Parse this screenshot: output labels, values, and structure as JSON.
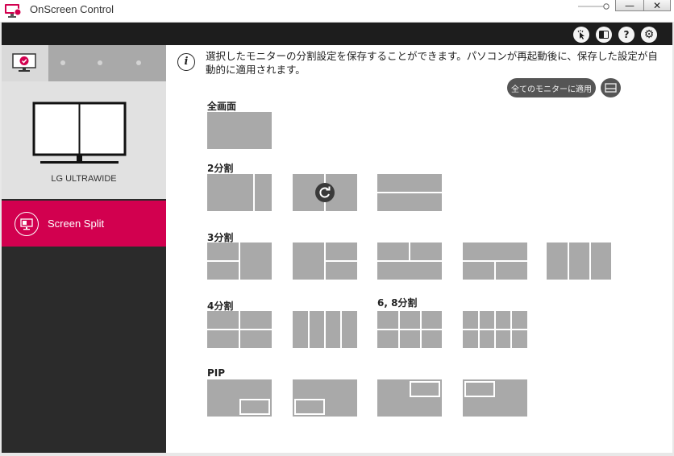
{
  "window": {
    "title": "OnScreen Control",
    "minimize_glyph": "—",
    "close_glyph": "✕"
  },
  "toolbar": {
    "icons": [
      "cursor-icon",
      "display-icon",
      "help-icon",
      "settings-icon"
    ],
    "help_glyph": "?",
    "settings_glyph": "⚙"
  },
  "sidebar": {
    "monitor_name": "LG ULTRAWIDE",
    "menu_items": [
      {
        "label": "Screen Split",
        "active": true
      }
    ]
  },
  "main": {
    "info_glyph": "i",
    "info_text": "選択したモニターの分割設定を保存することができます。パソコンが再起動後に、保存した設定が自動的に適用されます。",
    "apply_all_label": "全てのモニターに適用",
    "sections": {
      "full": "全画面",
      "split2": "2分割",
      "split3": "3分割",
      "split4": "4分割",
      "split68": "6, 8分割",
      "pip": "PIP"
    }
  },
  "colors": {
    "accent": "#d2004f",
    "sidebar_bg": "#2b2b2b",
    "toolbar_bg": "#1d1d1d",
    "layout_gray": "#a9a9a9"
  }
}
